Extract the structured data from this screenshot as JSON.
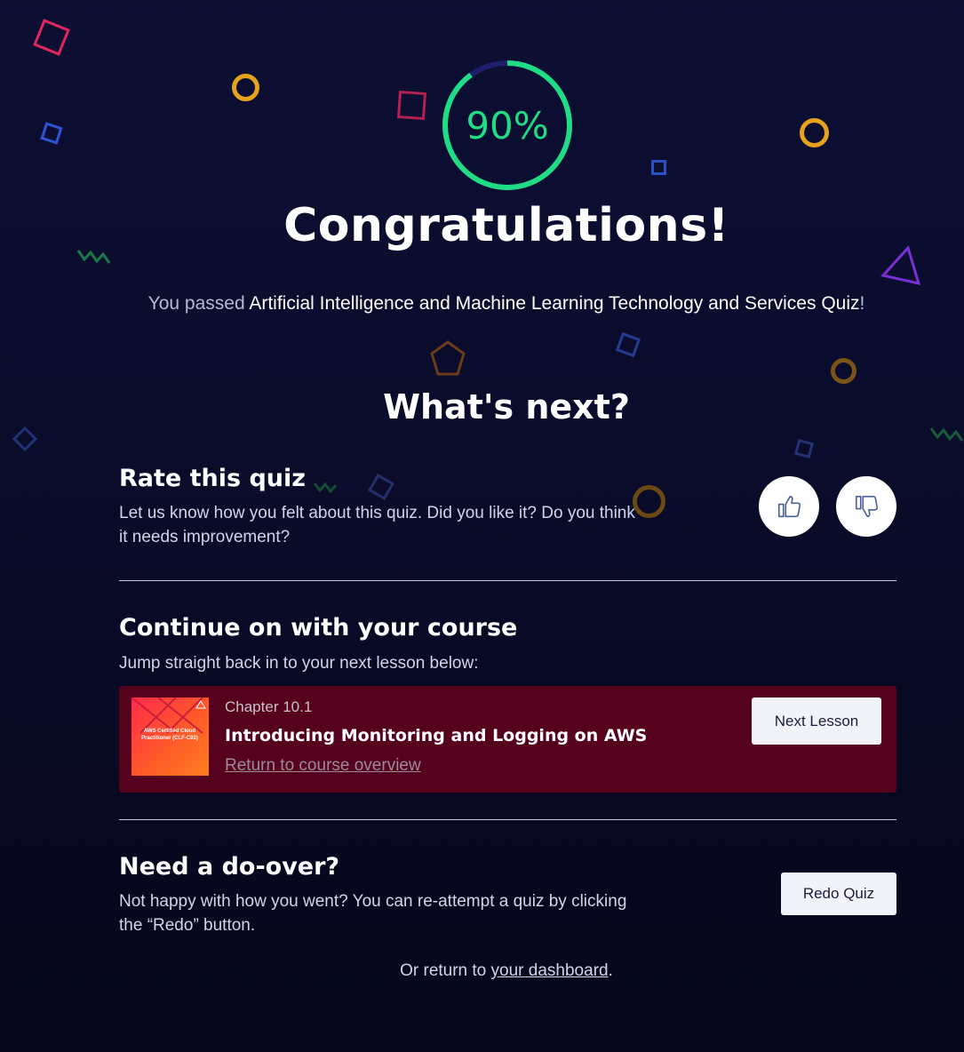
{
  "score": {
    "value": 90,
    "label": "90%",
    "fraction": 0.9
  },
  "colors": {
    "success": "#1fdc85",
    "lesson_card": "#56021f",
    "background": "#0a0c2c"
  },
  "title": "Congratulations!",
  "subtitle": {
    "prefix": "You passed",
    "quiz_name": "Artificial Intelligence and Machine Learning Technology and Services Quiz",
    "suffix": "!"
  },
  "whats_next": "What's next?",
  "rate": {
    "heading": "Rate this quiz",
    "description": "Let us know how you felt about this quiz. Did you like it? Do you think it needs improvement?",
    "like_icon": "thumbs-up-icon",
    "dislike_icon": "thumbs-down-icon"
  },
  "continue": {
    "heading": "Continue on with your course",
    "description": "Jump straight back in to your next lesson below:",
    "lesson": {
      "chapter": "Chapter 10.1",
      "title": "Introducing Monitoring and Logging on AWS",
      "overview_link": "Return to course overview",
      "thumbnail_text": "AWS Certified Cloud Practitioner (CLF-C02)",
      "next_button": "Next Lesson"
    }
  },
  "redo": {
    "heading": "Need a do-over?",
    "description": "Not happy with how you went? You can re-attempt a quiz by clicking the “Redo” button.",
    "button": "Redo Quiz"
  },
  "footer": {
    "prefix": "Or return to",
    "link": "your dashboard",
    "suffix": "."
  }
}
